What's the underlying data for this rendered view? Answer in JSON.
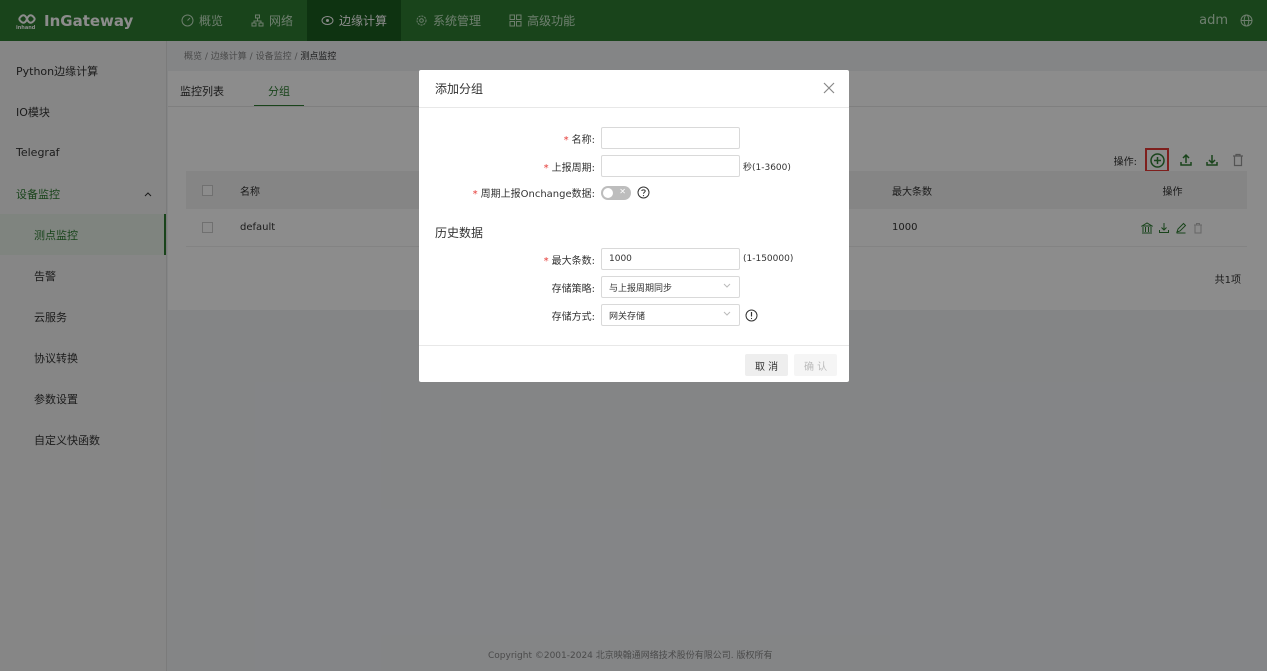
{
  "brand": {
    "name": "InGateway",
    "logo_text": "inhand"
  },
  "nav": [
    {
      "label": "概览",
      "icon": "dashboard-icon"
    },
    {
      "label": "网络",
      "icon": "network-icon"
    },
    {
      "label": "边缘计算",
      "icon": "edge-compute-icon",
      "active": true
    },
    {
      "label": "系统管理",
      "icon": "gear-icon"
    },
    {
      "label": "高级功能",
      "icon": "grid-icon"
    }
  ],
  "user": {
    "name": "adm"
  },
  "sidebar": {
    "items": [
      {
        "label": "Python边缘计算"
      },
      {
        "label": "IO模块"
      },
      {
        "label": "Telegraf"
      },
      {
        "label": "设备监控",
        "group": true
      },
      {
        "label": "测点监控",
        "active": true
      },
      {
        "label": "告警"
      },
      {
        "label": "云服务"
      },
      {
        "label": "协议转换"
      },
      {
        "label": "参数设置"
      },
      {
        "label": "自定义快函数"
      }
    ]
  },
  "breadcrumb": [
    "概览",
    "边缘计算",
    "设备监控",
    "测点监控"
  ],
  "tabs": [
    {
      "label": "监控列表"
    },
    {
      "label": "分组",
      "active": true
    }
  ],
  "ops_label": "操作:",
  "table": {
    "headers": {
      "name": "名称",
      "max": "最大条数",
      "op": "操作"
    },
    "rows": [
      {
        "name": "default",
        "max": "1000"
      }
    ],
    "total": "共1项"
  },
  "footer": "Copyright ©2001-2024 北京映翰通网络技术股份有限公司. 版权所有",
  "modal": {
    "title": "添加分组",
    "name_label": "名称:",
    "name_value": "",
    "period_label": "上报周期:",
    "period_value": "",
    "period_suffix": "秒(1-3600)",
    "onchange_label": "周期上报Onchange数据:",
    "onchange_on": false,
    "history_title": "历史数据",
    "max_label": "最大条数:",
    "max_value": "1000",
    "max_suffix": "(1-150000)",
    "strategy_label": "存储策略:",
    "strategy_value": "与上报周期同步",
    "method_label": "存储方式:",
    "method_value": "网关存储",
    "cancel": "取 消",
    "confirm": "确 认"
  },
  "colors": {
    "primary": "#2e7d32",
    "highlight": "#e53935"
  }
}
